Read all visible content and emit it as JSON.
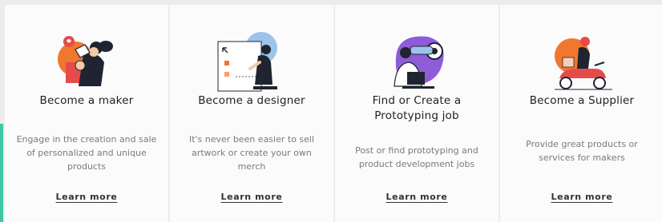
{
  "cards": [
    {
      "title": "Become a maker",
      "description": "Engage in the creation and sale of personalized and unique products",
      "link": "Learn more",
      "icon": "maker-illustration-icon"
    },
    {
      "title": "Become a designer",
      "description": "It's never been easier to sell artwork or create your own merch",
      "link": "Learn more",
      "icon": "designer-illustration-icon"
    },
    {
      "title": "Find or Create a Prototyping job",
      "description": "Post or find prototyping and product development jobs",
      "link": "Learn more",
      "icon": "prototyping-illustration-icon"
    },
    {
      "title": "Become a Supplier",
      "description": "Provide great products or services for makers",
      "link": "Learn more",
      "icon": "supplier-illustration-icon"
    }
  ],
  "colors": {
    "accent_bar": "#3fc8a6",
    "orange": "#f0772f",
    "purple": "#8e5cd9",
    "blue": "#9cc3ea",
    "red": "#e54b4b",
    "dark": "#1f2430"
  }
}
